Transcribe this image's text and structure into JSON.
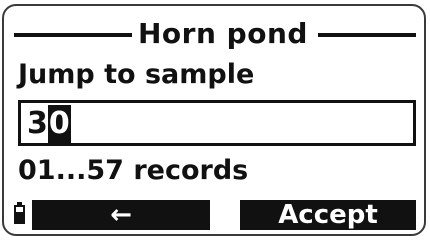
{
  "header": {
    "title": "Horn pond"
  },
  "dialog": {
    "prompt": "Jump to sample",
    "input_value": "30",
    "input_digits": [
      "3",
      "0"
    ],
    "records_range": "01...57 records"
  },
  "softkeys": {
    "back_label": "←",
    "accept_label": "Accept"
  },
  "icons": {
    "battery": "battery-icon",
    "back": "left-arrow-icon"
  }
}
